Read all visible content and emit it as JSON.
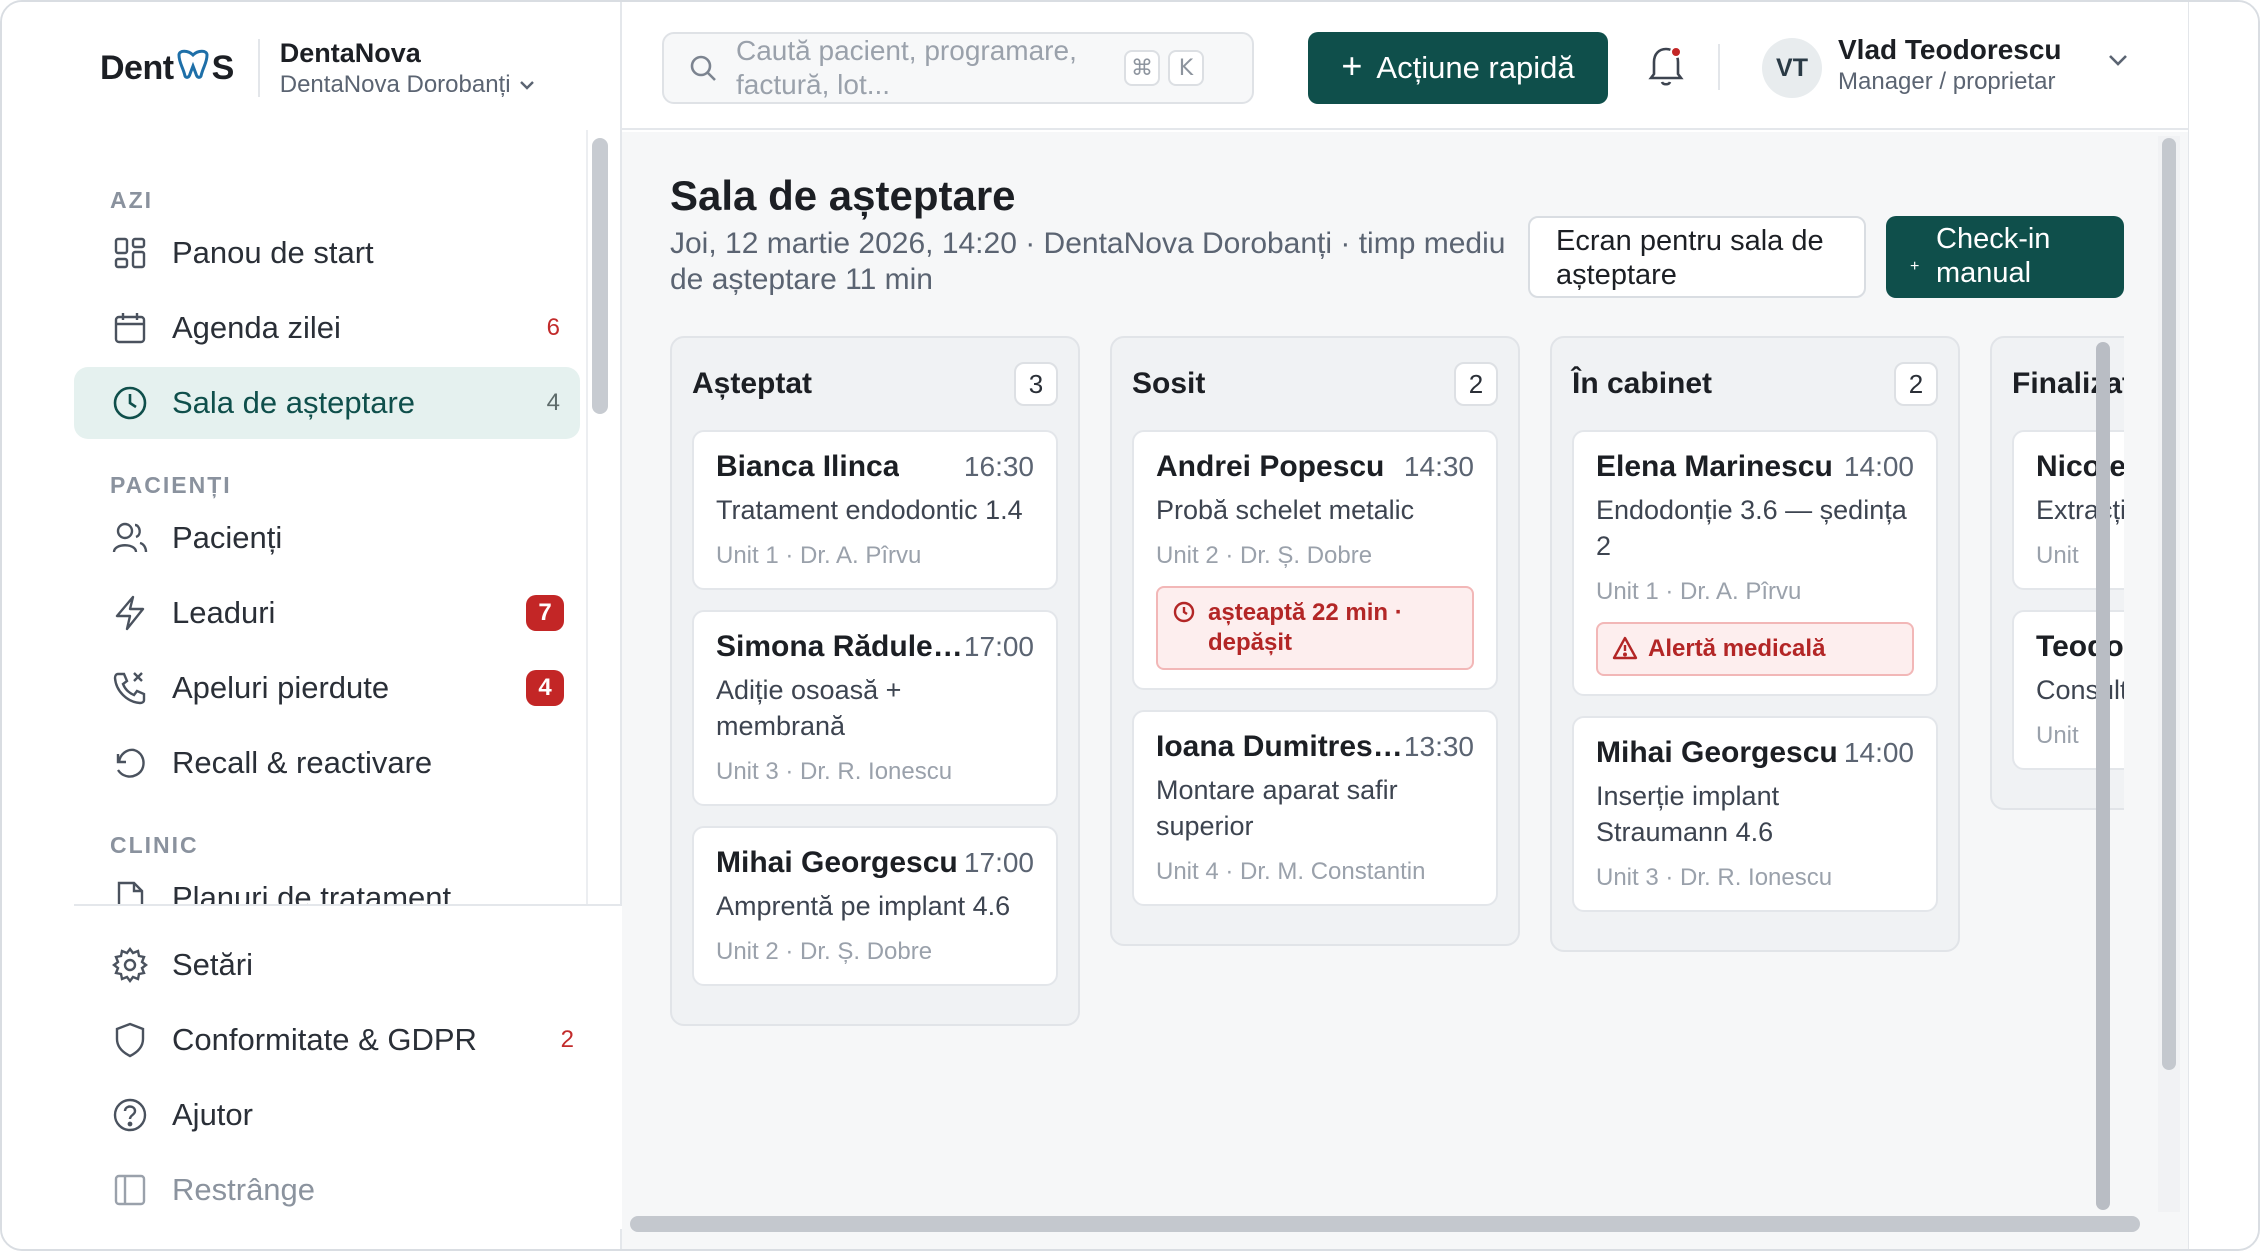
{
  "brand": {
    "logo_left": "Dent",
    "logo_right": "S",
    "name": "DentaNova",
    "branch": "DentaNova Dorobanți"
  },
  "search": {
    "placeholder": "Caută pacient, programare, factură, lot...",
    "kbd1": "⌘",
    "kbd2": "K"
  },
  "header": {
    "quick_action": "Acțiune rapidă",
    "user_initials": "VT",
    "user_name": "Vlad Teodorescu",
    "user_role": "Manager / proprietar"
  },
  "nav": {
    "section_today": "AZI",
    "section_patients": "PACIENȚI",
    "section_clinic": "CLINIC",
    "items": [
      {
        "label": "Panou de start",
        "count": "",
        "icon": "dashboard-icon"
      },
      {
        "label": "Agenda zilei",
        "count": "6",
        "icon": "calendar-icon"
      },
      {
        "label": "Sala de așteptare",
        "count": "4",
        "icon": "clock-icon"
      },
      {
        "label": "Pacienți",
        "count": "",
        "icon": "users-icon"
      },
      {
        "label": "Leaduri",
        "count": "7",
        "icon": "bolt-icon"
      },
      {
        "label": "Apeluri pierdute",
        "count": "4",
        "icon": "missed-call-icon"
      },
      {
        "label": "Recall & reactivare",
        "count": "",
        "icon": "refresh-icon"
      },
      {
        "label": "Planuri de tratament",
        "count": "",
        "icon": "document-icon"
      }
    ],
    "bottom": [
      {
        "label": "Setări",
        "count": ""
      },
      {
        "label": "Conformitate & GDPR",
        "count": "2"
      },
      {
        "label": "Ajutor",
        "count": ""
      },
      {
        "label": "Restrânge",
        "count": ""
      }
    ]
  },
  "page": {
    "title": "Sala de așteptare",
    "subtitle": "Joi, 12 martie 2026, 14:20 · DentaNova Dorobanți · timp mediu de așteptare 11 min",
    "btn_screen": "Ecran pentru sala de așteptare",
    "btn_checkin": "Check-in manual"
  },
  "board": {
    "columns": [
      {
        "title": "Așteptat",
        "count": "3",
        "cards": [
          {
            "name": "Bianca Ilinca",
            "time": "16:30",
            "proc": "Tratament endodontic 1.4",
            "meta": "Unit 1 · Dr. A. Pîrvu",
            "alert": ""
          },
          {
            "name": "Simona Rădulescu",
            "time": "17:00",
            "proc": "Adiție osoasă + membrană",
            "meta": "Unit 3 · Dr. R. Ionescu",
            "alert": ""
          },
          {
            "name": "Mihai Georgescu",
            "time": "17:00",
            "proc": "Amprentă pe implant 4.6",
            "meta": "Unit 2 · Dr. Ș. Dobre",
            "alert": ""
          }
        ]
      },
      {
        "title": "Sosit",
        "count": "2",
        "cards": [
          {
            "name": "Andrei Popescu",
            "time": "14:30",
            "proc": "Probă schelet metalic",
            "meta": "Unit 2 · Dr. Ș. Dobre",
            "alert": "așteaptă 22 min · depășit"
          },
          {
            "name": "Ioana Dumitrescu",
            "time": "13:30",
            "proc": "Montare aparat safir superior",
            "meta": "Unit 4 · Dr. M. Constantin",
            "alert": ""
          }
        ]
      },
      {
        "title": "În cabinet",
        "count": "2",
        "cards": [
          {
            "name": "Elena Marinescu",
            "time": "14:00",
            "proc": "Endodonție 3.6 — ședința 2",
            "meta": "Unit 1 · Dr. A. Pîrvu",
            "alert": "Alertă medicală"
          },
          {
            "name": "Mihai Georgescu",
            "time": "14:00",
            "proc": "Inserție implant Straumann 4.6",
            "meta": "Unit 3 · Dr. R. Ionescu",
            "alert": ""
          }
        ]
      },
      {
        "title": "Finalizat",
        "count": "",
        "cards": [
          {
            "name": "Nicoleta",
            "time": "",
            "proc": "Extracție consult",
            "meta": "Unit",
            "alert": ""
          },
          {
            "name": "Teodor",
            "time": "",
            "proc": "Consult plan",
            "meta": "Unit",
            "alert": ""
          }
        ]
      }
    ]
  }
}
